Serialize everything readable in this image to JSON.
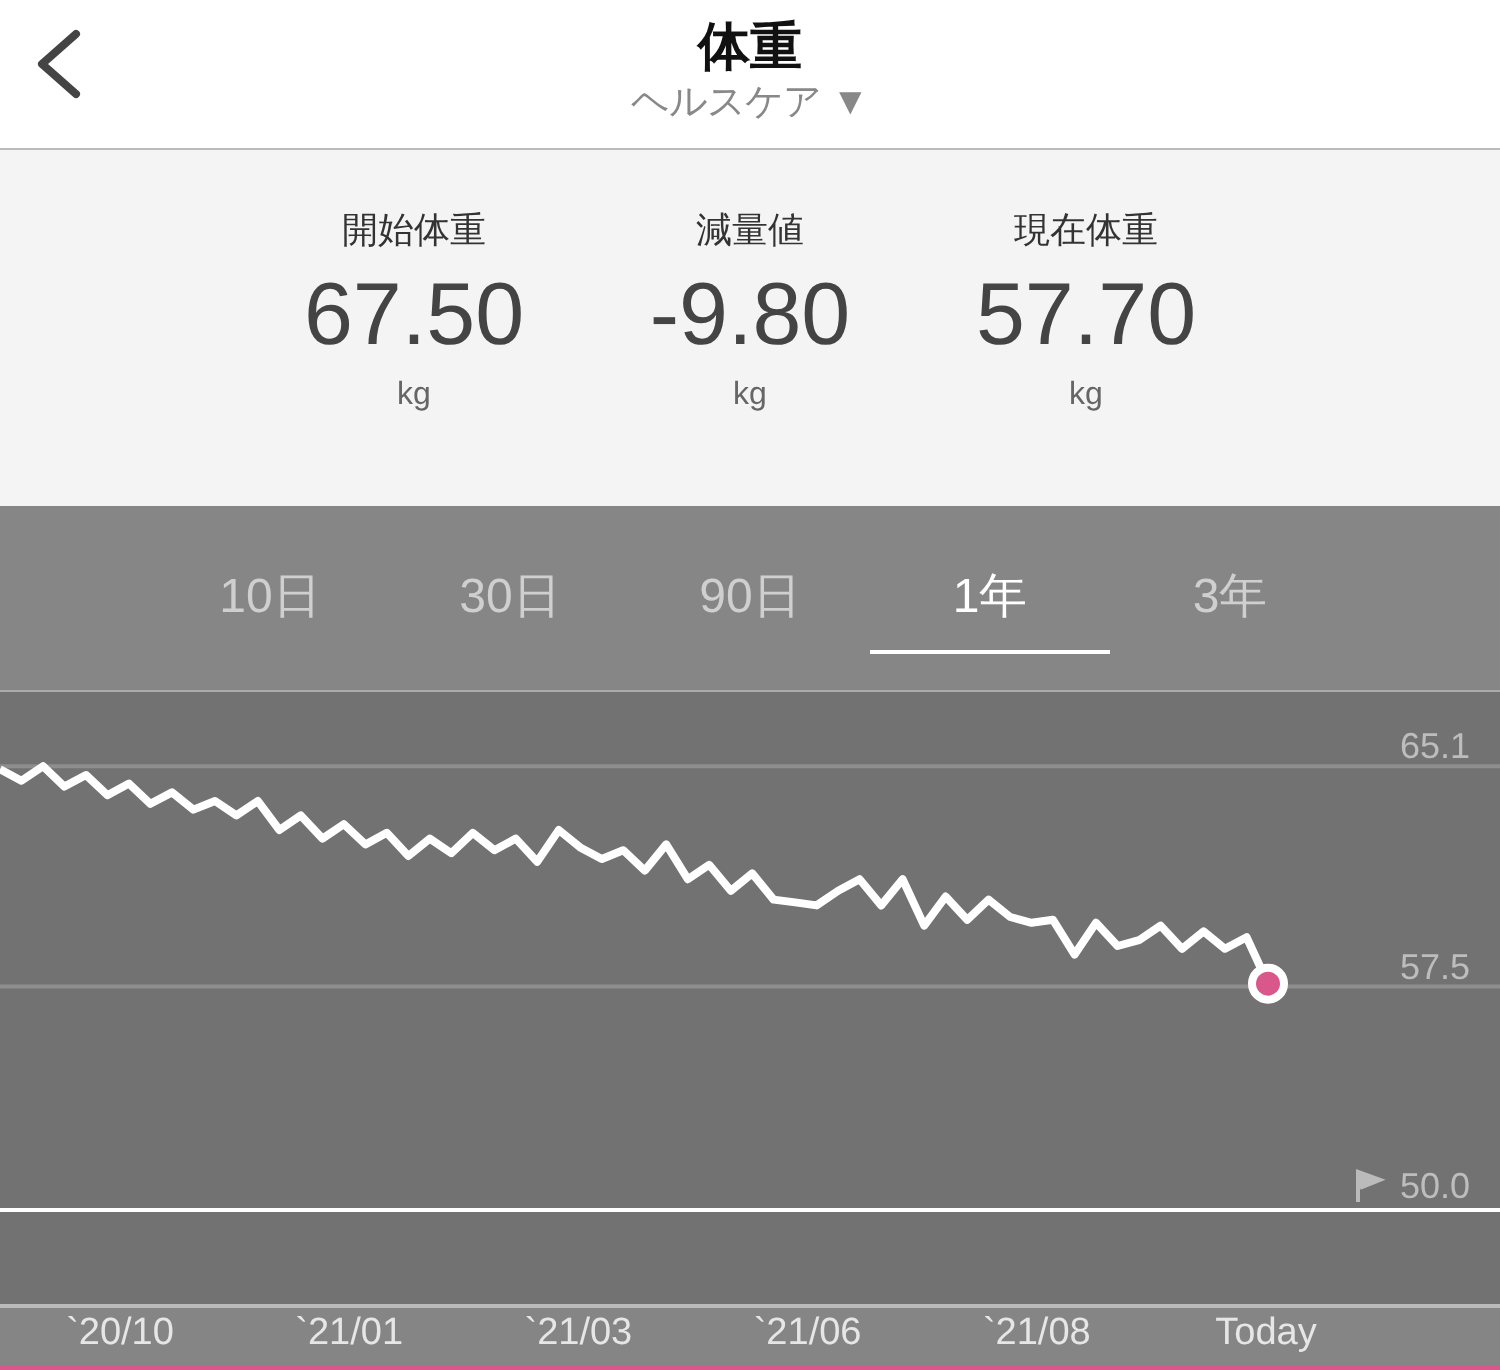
{
  "header": {
    "title": "体重",
    "subtitle": "ヘルスケア ▼"
  },
  "stats": [
    {
      "label": "開始体重",
      "value": "67.50",
      "unit": "kg"
    },
    {
      "label": "減量値",
      "value": "-9.80",
      "unit": "kg"
    },
    {
      "label": "現在体重",
      "value": "57.70",
      "unit": "kg"
    }
  ],
  "tabs": [
    {
      "label": "10日",
      "selected": false
    },
    {
      "label": "30日",
      "selected": false
    },
    {
      "label": "90日",
      "selected": false
    },
    {
      "label": "1年",
      "selected": true
    },
    {
      "label": "3年",
      "selected": false
    }
  ],
  "chart": {
    "chart_data": {
      "type": "line",
      "ylim": [
        49.86,
        67.66
      ],
      "yticks": [
        {
          "value": 50.0,
          "label": "50.0"
        },
        {
          "value": 57.5,
          "label": "57.5"
        },
        {
          "value": 65.1,
          "label": "65.1"
        }
      ],
      "series": [
        {
          "color": "#ffffff",
          "values": [
            65.0,
            64.6,
            65.1,
            64.4,
            64.8,
            64.1,
            64.5,
            63.8,
            64.2,
            63.6,
            63.9,
            63.4,
            63.9,
            62.9,
            63.4,
            62.6,
            63.1,
            62.4,
            62.8,
            62.0,
            62.6,
            62.1,
            62.8,
            62.2,
            62.6,
            61.8,
            62.9,
            62.3,
            61.9,
            62.2,
            61.5,
            62.4,
            61.2,
            61.7,
            60.8,
            61.4,
            60.5,
            60.4,
            60.3,
            60.8,
            61.2,
            60.3,
            61.2,
            59.6,
            60.6,
            59.8,
            60.5,
            59.9,
            59.7,
            59.8,
            58.6,
            59.7,
            58.9,
            59.1,
            59.6,
            58.8,
            59.4,
            58.8,
            59.2,
            57.6
          ]
        }
      ],
      "stacked": false
    },
    "x_labels": [
      "`20/10",
      "`21/01",
      "`21/03",
      "`21/06",
      "`21/08",
      "Today"
    ]
  }
}
